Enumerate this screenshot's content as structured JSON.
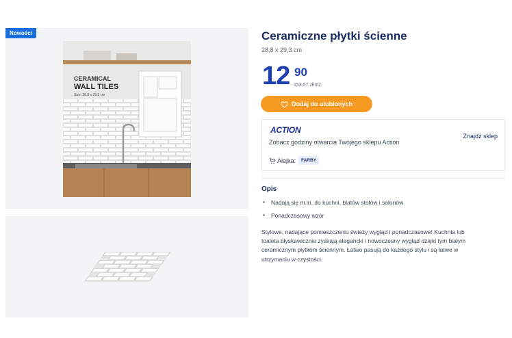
{
  "gallery": {
    "badge": "Nowości",
    "photo": {
      "brand_line": "CERAMICAL",
      "product_line": "WALL TILES",
      "size_line": "Size: 28.8 x 29.3 cm"
    }
  },
  "product": {
    "title": "Ceramiczne płytki ścienne",
    "size": "28,8 x 29,3 cm",
    "price_int": "12",
    "price_dec": "90",
    "unit_price": "153,57 zł/m2",
    "favorite_label": "Dodaj do ulubionych"
  },
  "store": {
    "logo": "ACTION",
    "hours_text": "Zobacz godziny otwarcia Twojego sklepu Action",
    "find_label": "Znajdź sklep",
    "aisle_label": "Alejka:",
    "aisle_value": "FARBY"
  },
  "description": {
    "heading": "Opis",
    "bullets": [
      "Nadają się m.in. do kuchni, blatów stołów i salonów",
      "Ponadczasowy wzór"
    ],
    "text": "Stylowe, nadające pomieszczeniu świeży wygląd i ponadczasowe! Kuchnia lub toaleta błyskawicznie zyskają elegancki i nowoczesny wygląd dzięki tym białym ceramicznym płytkom ściennym. Łatwo pasują do każdego stylu i są łatwe w utrzymaniu w czystości."
  },
  "colors": {
    "price": "#1e3fb0",
    "accent_orange": "#f79a22",
    "brand_blue": "#1a6fe0",
    "heading": "#1b2c63"
  }
}
